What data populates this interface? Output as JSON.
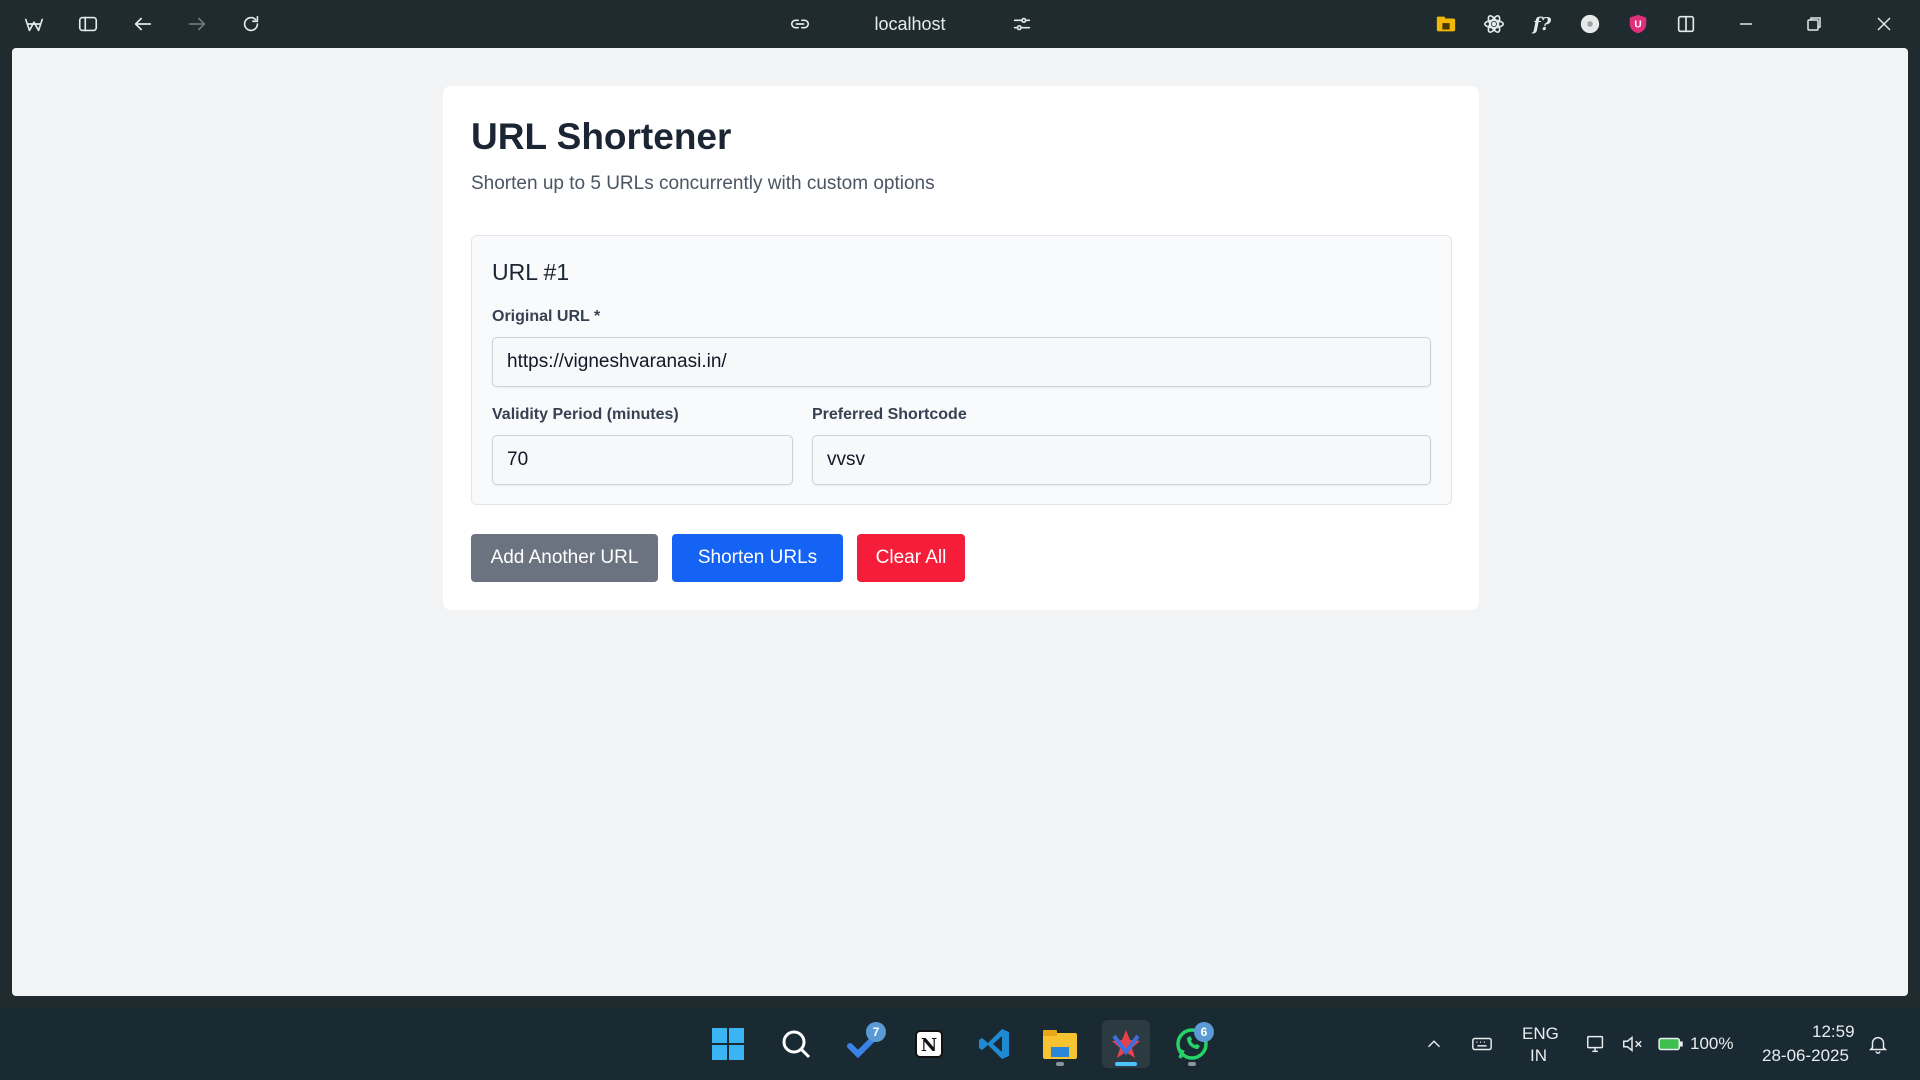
{
  "browser": {
    "address": "localhost",
    "icons": [
      "browser-logo-icon",
      "sidebar-icon",
      "back-icon",
      "forward-icon",
      "reload-icon",
      "link-icon",
      "site-settings-icon"
    ],
    "extensions": [
      "folder-extension-icon",
      "react-devtools-icon",
      "font-finder-icon",
      "profile-extension-icon",
      "ublock-icon",
      "split-view-icon"
    ]
  },
  "page": {
    "title": "URL Shortener",
    "subtitle": "Shorten up to 5 URLs concurrently with custom options",
    "url_block": {
      "title": "URL #1",
      "original_url_label": "Original URL *",
      "original_url_value": "https://vigneshvaranasi.in/",
      "validity_label": "Validity Period (minutes)",
      "validity_value": "70",
      "shortcode_label": "Preferred Shortcode",
      "shortcode_value": "vvsv"
    },
    "buttons": {
      "add": "Add Another URL",
      "shorten": "Shorten URLs",
      "clear": "Clear All"
    }
  },
  "colors": {
    "add_button": "#6b7280",
    "shorten_button": "#1463f5",
    "clear_button": "#f51d3a",
    "title": "#1c2533"
  },
  "taskbar": {
    "apps": [
      "windows-start-icon",
      "search-icon",
      "todo-icon",
      "notion-icon",
      "vscode-icon",
      "file-explorer-icon",
      "browser-app-icon",
      "whatsapp-icon"
    ],
    "todo_badge": "7",
    "whatsapp_badge": "6",
    "language_line1": "ENG",
    "language_line2": "IN",
    "battery": "100%",
    "time": "12:59",
    "date": "28-06-2025"
  }
}
